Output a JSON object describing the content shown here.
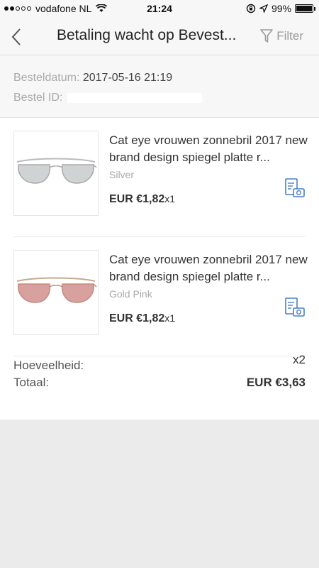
{
  "status_bar": {
    "carrier": "vodafone NL",
    "time": "21:24",
    "battery": "99%",
    "battery_level": 0.99
  },
  "nav": {
    "title": "Betaling wacht op Bevest...",
    "filter_label": "Filter"
  },
  "order": {
    "date_label": "Besteldatum:",
    "date_value": "2017-05-16 21:19",
    "id_label": "Bestel ID:"
  },
  "items": [
    {
      "title": "Cat eye vrouwen zonnebril 2017 new brand design spiegel platte r...",
      "variant": "Silver",
      "price": "EUR €1,82",
      "quantity": "x1"
    },
    {
      "title": "Cat eye vrouwen zonnebril 2017 new brand design spiegel platte r...",
      "variant": "Gold Pink",
      "price": "EUR €1,82",
      "quantity": "x1"
    }
  ],
  "summary": {
    "quantity_label": "Hoeveelheid:",
    "quantity_value": "x2",
    "total_label": "Totaal:",
    "total_value": "EUR €3,63"
  },
  "colors": {
    "accent_blue": "#4a7fc9",
    "silver_lens": "#cfd3d3",
    "pink_lens": "#d9a19e"
  }
}
